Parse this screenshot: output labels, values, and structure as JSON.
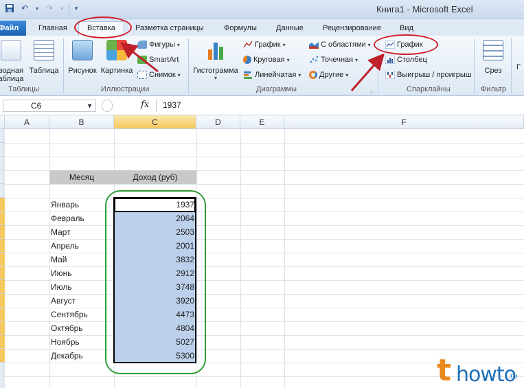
{
  "window": {
    "title": "Книга1  -  Microsoft Excel"
  },
  "qat": {
    "save": "save-icon",
    "undo": "undo-icon",
    "redo": "redo-icon"
  },
  "tabs": [
    {
      "label": "Файл"
    },
    {
      "label": "Главная"
    },
    {
      "label": "Вставка"
    },
    {
      "label": "Разметка страницы"
    },
    {
      "label": "Формулы"
    },
    {
      "label": "Данные"
    },
    {
      "label": "Рецензирование"
    },
    {
      "label": "Вид"
    }
  ],
  "ribbon": {
    "tables": {
      "pivot_line1": "водная",
      "pivot_line2": "аблица",
      "table": "Таблица",
      "group": "Таблицы"
    },
    "illustrations": {
      "picture": "Рисунок",
      "clipart": "Картинка",
      "shapes": "Фигуры",
      "smartart": "SmartArt",
      "screenshot": "Снимок",
      "group": "Иллюстрации"
    },
    "charts": {
      "histogram": "Гистограмма",
      "line": "График",
      "pie": "Круговая",
      "bar": "Линейчатая",
      "area": "С областями",
      "scatter": "Точечная",
      "other": "Другие",
      "group": "Диаграммы"
    },
    "sparklines": {
      "line": "График",
      "column": "Столбец",
      "winloss": "Выигрыш / проигрыш",
      "group": "Спарклайны"
    },
    "filter": {
      "slicer": "Срез",
      "group": "Фильтр"
    }
  },
  "formula_bar": {
    "cell": "C6",
    "fx": "fx",
    "value": "1937"
  },
  "columns": [
    "A",
    "B",
    "C",
    "D",
    "E",
    "F"
  ],
  "table": {
    "headers": {
      "month": "Месяц",
      "income": "Доход (руб)"
    },
    "rows": [
      {
        "month": "Январь",
        "value": "1937"
      },
      {
        "month": "Февраль",
        "value": "2064"
      },
      {
        "month": "Март",
        "value": "2503"
      },
      {
        "month": "Апрель",
        "value": "2001"
      },
      {
        "month": "Май",
        "value": "3832"
      },
      {
        "month": "Июнь",
        "value": "2912"
      },
      {
        "month": "Июль",
        "value": "3748"
      },
      {
        "month": "Август",
        "value": "3920"
      },
      {
        "month": "Сентябрь",
        "value": "4473"
      },
      {
        "month": "Октябрь",
        "value": "4804"
      },
      {
        "month": "Ноябрь",
        "value": "5027"
      },
      {
        "month": "Декабрь",
        "value": "5300"
      }
    ]
  },
  "logo": {
    "t": "t",
    "main": "howto",
    "suffix": ".ru"
  },
  "colors": {
    "selection": "#bcd0ec",
    "annotation_red": "#d0202a",
    "annotation_green": "#2e9b35",
    "selected_header": "#f6c860"
  }
}
